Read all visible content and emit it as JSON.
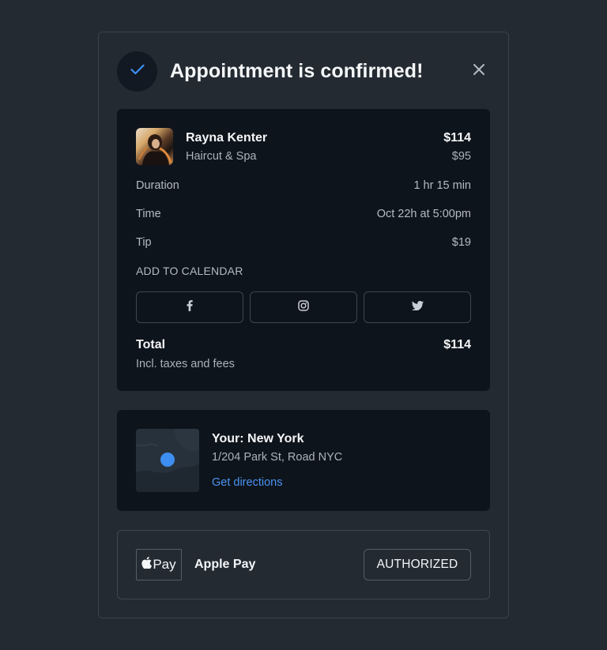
{
  "header": {
    "title": "Appointment is confirmed!",
    "check_icon": "check-icon",
    "close_icon": "close-icon"
  },
  "booking": {
    "client_name": "Rayna Kenter",
    "service": "Haircut & Spa",
    "price_total": "$114",
    "price_service": "$95",
    "details": [
      {
        "label": "Duration",
        "value": "1 hr 15 min"
      },
      {
        "label": "Time",
        "value": "Oct 22h at 5:00pm"
      },
      {
        "label": "Tip",
        "value": "$19"
      }
    ],
    "calendar_label": "ADD TO CALENDAR",
    "social_icons": [
      "facebook-icon",
      "instagram-icon",
      "twitter-icon"
    ],
    "total_label": "Total",
    "total_note": "Incl. taxes and fees",
    "total_value": "$114"
  },
  "location": {
    "title": "Your: New York",
    "address": "1/204 Park St, Road NYC",
    "link": "Get directions"
  },
  "payment": {
    "logo_text": "Pay",
    "method": "Apple Pay",
    "status": "AUTHORIZED"
  },
  "colors": {
    "background": "#232a31",
    "card": "#0e141b",
    "accent": "#4a94f2",
    "check": "#3d8ef0"
  }
}
